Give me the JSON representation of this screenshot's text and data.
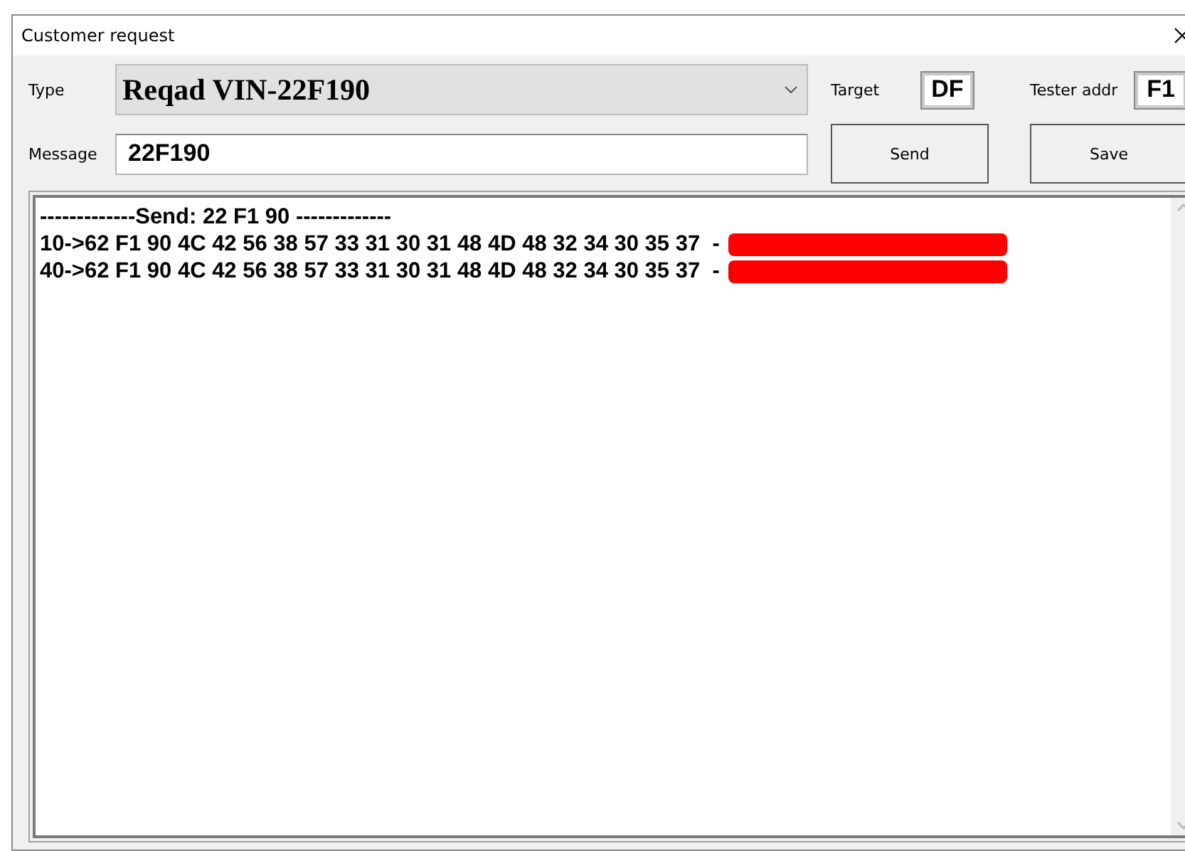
{
  "window": {
    "title": "Customer request"
  },
  "type": {
    "label": "Type",
    "value": "Reqad VIN-22F190"
  },
  "target": {
    "label": "Target",
    "value": "DF"
  },
  "tester": {
    "label": "Tester addr",
    "value": "F1"
  },
  "message": {
    "label": "Message",
    "value": "22F190"
  },
  "buttons": [
    "Send",
    "Save"
  ],
  "log": [
    {
      "text": "-------------Send: 22 F1 90 -------------",
      "redacted": false
    },
    {
      "text": "10->62 F1 90 4C 42 56 38 57 33 31 30 31 48 4D 48 32 34 30 35 37  -",
      "redacted": true
    },
    {
      "text": "40->62 F1 90 4C 42 56 38 57 33 31 30 31 48 4D 48 32 34 30 35 37  -",
      "redacted": true
    }
  ]
}
